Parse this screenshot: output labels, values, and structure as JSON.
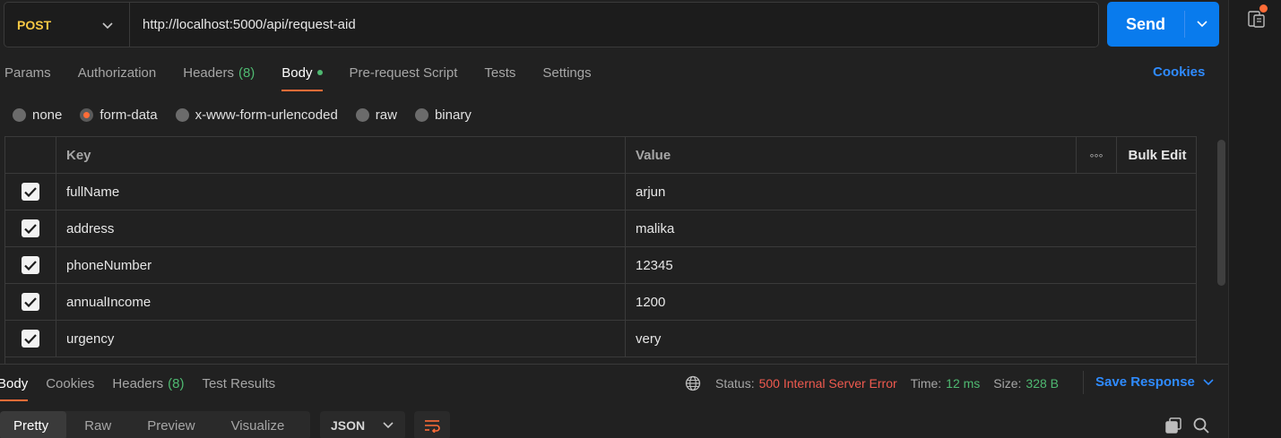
{
  "request": {
    "method": "POST",
    "url": "http://localhost:5000/api/request-aid",
    "send_label": "Send"
  },
  "request_tabs": [
    {
      "label": "Params"
    },
    {
      "label": "Authorization"
    },
    {
      "label": "Headers",
      "count": "(8)"
    },
    {
      "label": "Body",
      "active": true
    },
    {
      "label": "Pre-request Script"
    },
    {
      "label": "Tests"
    },
    {
      "label": "Settings"
    }
  ],
  "cookies_label": "Cookies",
  "body_types": [
    {
      "label": "none",
      "selected": false
    },
    {
      "label": "form-data",
      "selected": true
    },
    {
      "label": "x-www-form-urlencoded",
      "selected": false
    },
    {
      "label": "raw",
      "selected": false
    },
    {
      "label": "binary",
      "selected": false
    }
  ],
  "table": {
    "key_header": "Key",
    "value_header": "Value",
    "more_label": "◦◦◦",
    "bulk_edit_label": "Bulk Edit",
    "rows": [
      {
        "key": "fullName",
        "value": "arjun",
        "checked": true
      },
      {
        "key": "address",
        "value": "malika",
        "checked": true
      },
      {
        "key": "phoneNumber",
        "value": "12345",
        "checked": true
      },
      {
        "key": "annualIncome",
        "value": "1200",
        "checked": true
      },
      {
        "key": "urgency",
        "value": "very",
        "checked": true
      }
    ]
  },
  "response": {
    "tabs": [
      {
        "label": "Body",
        "active": true
      },
      {
        "label": "Cookies"
      },
      {
        "label": "Headers",
        "count": "(8)"
      },
      {
        "label": "Test Results"
      }
    ],
    "status_label": "Status:",
    "status_value": "500 Internal Server Error",
    "time_label": "Time:",
    "time_value": "12 ms",
    "size_label": "Size:",
    "size_value": "328 B",
    "save_label": "Save Response",
    "view_tabs": [
      "Pretty",
      "Raw",
      "Preview",
      "Visualize"
    ],
    "format": "JSON"
  },
  "colors": {
    "accent_orange": "#ff6c37",
    "send_blue": "#097bed",
    "link_blue": "#2f8bff",
    "method_yellow": "#f6c744",
    "success_green": "#4fb971",
    "error_red": "#f05a4f"
  }
}
